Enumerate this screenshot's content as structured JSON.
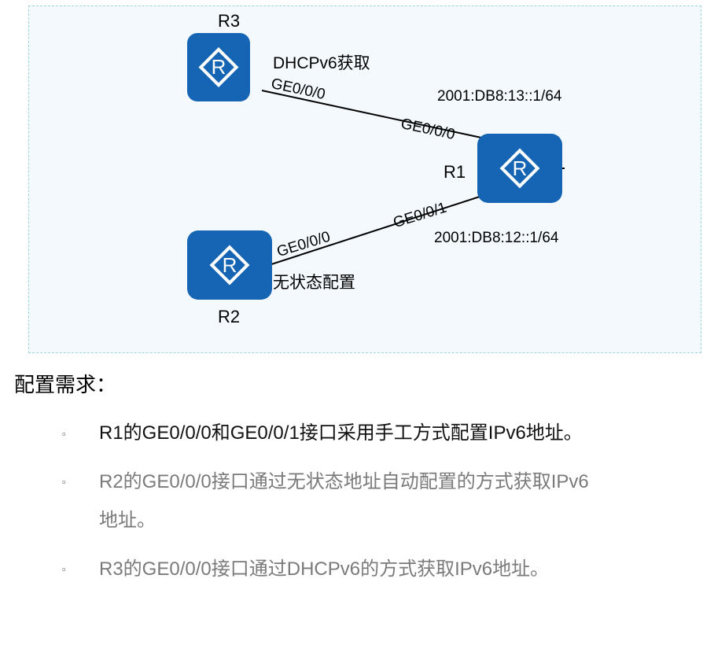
{
  "diagram": {
    "routers": {
      "r1": {
        "name": "R1"
      },
      "r2": {
        "name": "R2"
      },
      "r3": {
        "name": "R3"
      },
      "icon_letter": "R"
    },
    "links": {
      "r3_r1": {
        "r3_interface": "GE0/0/0",
        "r1_interface": "GE0/0/0",
        "method": "DHCPv6获取",
        "r1_address": "2001:DB8:13::1/64"
      },
      "r2_r1": {
        "r2_interface": "GE0/0/0",
        "r1_interface": "GE0/0/1",
        "method": "无状态配置",
        "r1_address": "2001:DB8:12::1/64"
      }
    },
    "colors": {
      "router": "#1565b4",
      "panel_bg": "#f3f9fd",
      "panel_border": "#9fd6da"
    }
  },
  "requirements": {
    "title": "配置需求：",
    "items": [
      {
        "text": "R1的GE0/0/0和GE0/0/1接口采用手工方式配置IPv6地址。"
      },
      {
        "line1": "R2的GE0/0/0接口通过无状态地址自动配置的方式获取IPv6",
        "line2": "地址。"
      },
      {
        "text": "R3的GE0/0/0接口通过DHCPv6的方式获取IPv6地址。"
      }
    ],
    "bullet": "▫"
  }
}
